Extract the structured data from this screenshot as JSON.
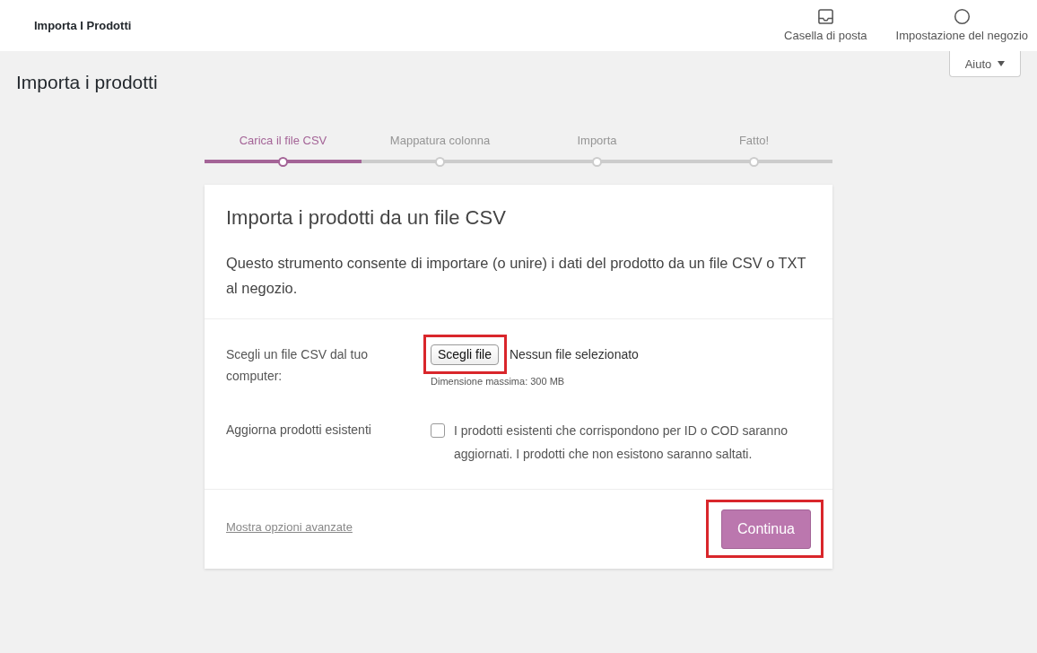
{
  "header": {
    "title": "Importa I Prodotti",
    "actions": [
      {
        "kind": "inbox",
        "label": "Casella di posta"
      },
      {
        "kind": "circle",
        "label": "Impostazione del negozio"
      }
    ]
  },
  "help_button": {
    "label": "Aiuto"
  },
  "page_title": "Importa i prodotti",
  "steps": [
    {
      "label": "Carica il file CSV",
      "selected": true
    },
    {
      "label": "Mappatura colonna",
      "selected": false
    },
    {
      "label": "Importa",
      "selected": false
    },
    {
      "label": "Fatto!",
      "selected": false
    }
  ],
  "card": {
    "title": "Importa i prodotti da un file CSV",
    "description": "Questo strumento consente di importare (o unire) i dati del prodotto da un file CSV o TXT al negozio.",
    "file_row": {
      "label": "Scegli un file CSV dal tuo computer:",
      "button": {
        "label": "Scegli file",
        "highlighted": true
      },
      "status": "Nessun file selezionato",
      "note": "Dimensione massima: 300 MB"
    },
    "update_row": {
      "label": "Aggiorna prodotti esistenti",
      "checkbox": {
        "checked": false,
        "label": "I prodotti esistenti che corrispondono per ID o COD saranno aggiornati. I prodotti che non esistono saranno saltati."
      }
    },
    "advanced_link": "Mostra opzioni avanzate",
    "continue_button": {
      "label": "Continua",
      "highlighted": true
    }
  }
}
